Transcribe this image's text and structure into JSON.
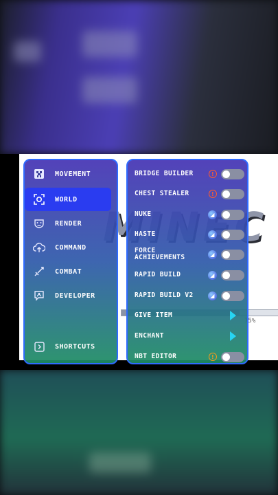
{
  "sidebar": {
    "items": [
      {
        "label": "MOVEMENT",
        "icon": "creeper-icon",
        "active": false
      },
      {
        "label": "WORLD",
        "icon": "world-icon",
        "active": true
      },
      {
        "label": "RENDER",
        "icon": "mask-icon",
        "active": false
      },
      {
        "label": "COMMAND",
        "icon": "cloud-upload-icon",
        "active": false
      },
      {
        "label": "COMBAT",
        "icon": "sword-icon",
        "active": false
      },
      {
        "label": "DEVELOPER",
        "icon": "chat-person-icon",
        "active": false
      }
    ],
    "shortcuts_label": "SHORTCUTS"
  },
  "modules": [
    {
      "label": "BRIDGE BUILDER",
      "indicator": "warning",
      "control": "toggle",
      "enabled": false
    },
    {
      "label": "CHEST STEALER",
      "indicator": "warning",
      "control": "toggle",
      "enabled": false
    },
    {
      "label": "NUKE",
      "indicator": "badge",
      "control": "toggle",
      "enabled": false
    },
    {
      "label": "HASTE",
      "indicator": "badge",
      "control": "toggle",
      "enabled": false
    },
    {
      "label": "FORCE ACHIEVEMENTS",
      "indicator": "badge",
      "control": "toggle",
      "enabled": false
    },
    {
      "label": "RAPID BUILD",
      "indicator": "badge",
      "control": "toggle",
      "enabled": false
    },
    {
      "label": "RAPID BUILD V2",
      "indicator": "badge",
      "control": "toggle",
      "enabled": false
    },
    {
      "label": "GIVE ITEM",
      "indicator": "none",
      "control": "arrow",
      "enabled": false
    },
    {
      "label": "ENCHANT",
      "indicator": "none",
      "control": "arrow",
      "enabled": false
    },
    {
      "label": "NBT EDITOR",
      "indicator": "warning-orange",
      "control": "toggle",
      "enabled": false
    }
  ],
  "background": {
    "loading_percent": 75,
    "loading_text": "75%"
  },
  "colors": {
    "accent": "#2f6bff",
    "active_item": "#2a3cf0",
    "warning": "#ff5a2e",
    "arrow": "#27d4f2"
  }
}
